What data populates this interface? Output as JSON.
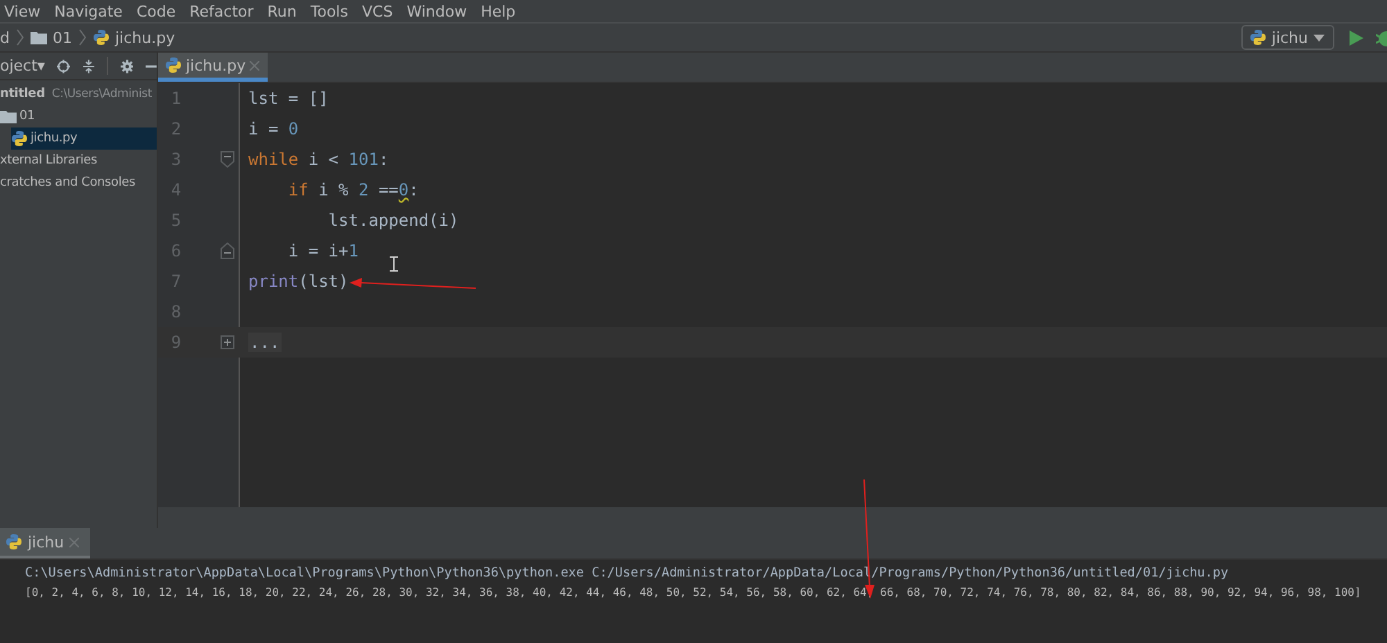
{
  "menu": [
    "View",
    "Navigate",
    "Code",
    "Refactor",
    "Run",
    "Tools",
    "VCS",
    "Window",
    "Help"
  ],
  "breadcrumbs": [
    {
      "label": "d",
      "kind": "text"
    },
    {
      "label": "01",
      "kind": "folder"
    },
    {
      "label": "jichu.py",
      "kind": "python"
    }
  ],
  "run_config": {
    "label": "jichu"
  },
  "project_panel": {
    "title": "oject▾",
    "tree": [
      {
        "label": "ntitled",
        "path": "C:\\Users\\Administ",
        "kind": "project",
        "selected": false,
        "children": [
          {
            "label": "01",
            "kind": "folder",
            "selected": false,
            "children": [
              {
                "label": "jichu.py",
                "kind": "python",
                "selected": true
              }
            ]
          }
        ]
      },
      {
        "label": "xternal Libraries",
        "kind": "library",
        "selected": false
      },
      {
        "label": "cratches and Consoles",
        "kind": "scratch",
        "selected": false
      }
    ]
  },
  "editor_tabs": [
    {
      "label": "jichu.py",
      "selected": true
    }
  ],
  "code_lines": [
    {
      "number": "1",
      "kind": "plain",
      "current": false,
      "tokens": [
        {
          "text": "lst = []",
          "kind": "plain"
        }
      ]
    },
    {
      "number": "2",
      "kind": "plain",
      "current": false,
      "tokens": [
        {
          "text": "i = ",
          "kind": "plain"
        },
        {
          "text": "0",
          "kind": "number"
        }
      ]
    },
    {
      "number": "3",
      "kind": "fold-start",
      "current": false,
      "tokens": [
        {
          "text": "while",
          "kind": "keyword"
        },
        {
          "text": " i < ",
          "kind": "plain"
        },
        {
          "text": "101",
          "kind": "number"
        },
        {
          "text": ":",
          "kind": "plain"
        }
      ]
    },
    {
      "number": "4",
      "kind": "plain",
      "current": false,
      "tokens": [
        {
          "text": "    if",
          "kind": "keyword"
        },
        {
          "text": " i % ",
          "kind": "plain"
        },
        {
          "text": "2",
          "kind": "number"
        },
        {
          "text": " ==",
          "kind": "plain"
        },
        {
          "text": "0",
          "kind": "warn-number"
        },
        {
          "text": ":",
          "kind": "plain"
        }
      ]
    },
    {
      "number": "5",
      "kind": "plain",
      "current": false,
      "tokens": [
        {
          "text": "        lst.append(i)",
          "kind": "plain"
        }
      ]
    },
    {
      "number": "6",
      "kind": "fold-end",
      "current": false,
      "tokens": [
        {
          "text": "    i = i+",
          "kind": "plain"
        },
        {
          "text": "1",
          "kind": "number"
        }
      ]
    },
    {
      "number": "7",
      "kind": "plain",
      "current": false,
      "tokens": [
        {
          "text": "print",
          "kind": "builtin"
        },
        {
          "text": "(lst)",
          "kind": "plain"
        }
      ]
    },
    {
      "number": "8",
      "kind": "plain",
      "current": false
    },
    {
      "number": "9",
      "kind": "folded",
      "current": true,
      "tokens": [
        {
          "text": "...",
          "kind": "folded"
        }
      ]
    }
  ],
  "run_panel": {
    "tabs": [
      {
        "label": "jichu",
        "selected": true
      }
    ],
    "output": [
      "C:\\Users\\Administrator\\AppData\\Local\\Programs\\Python\\Python36\\python.exe C:/Users/Administrator/AppData/Local/Programs/Python/Python36/untitled/01/jichu.py",
      "[0, 2, 4, 6, 8, 10, 12, 14, 16, 18, 20, 22, 24, 26, 28, 30, 32, 34, 36, 38, 40, 42, 44, 46, 48, 50, 52, 54, 56, 58, 60, 62, 64, 66, 68, 70, 72, 74, 76, 78, 80, 82, 84, 86, 88, 90, 92, 94, 96, 98, 100]"
    ]
  }
}
